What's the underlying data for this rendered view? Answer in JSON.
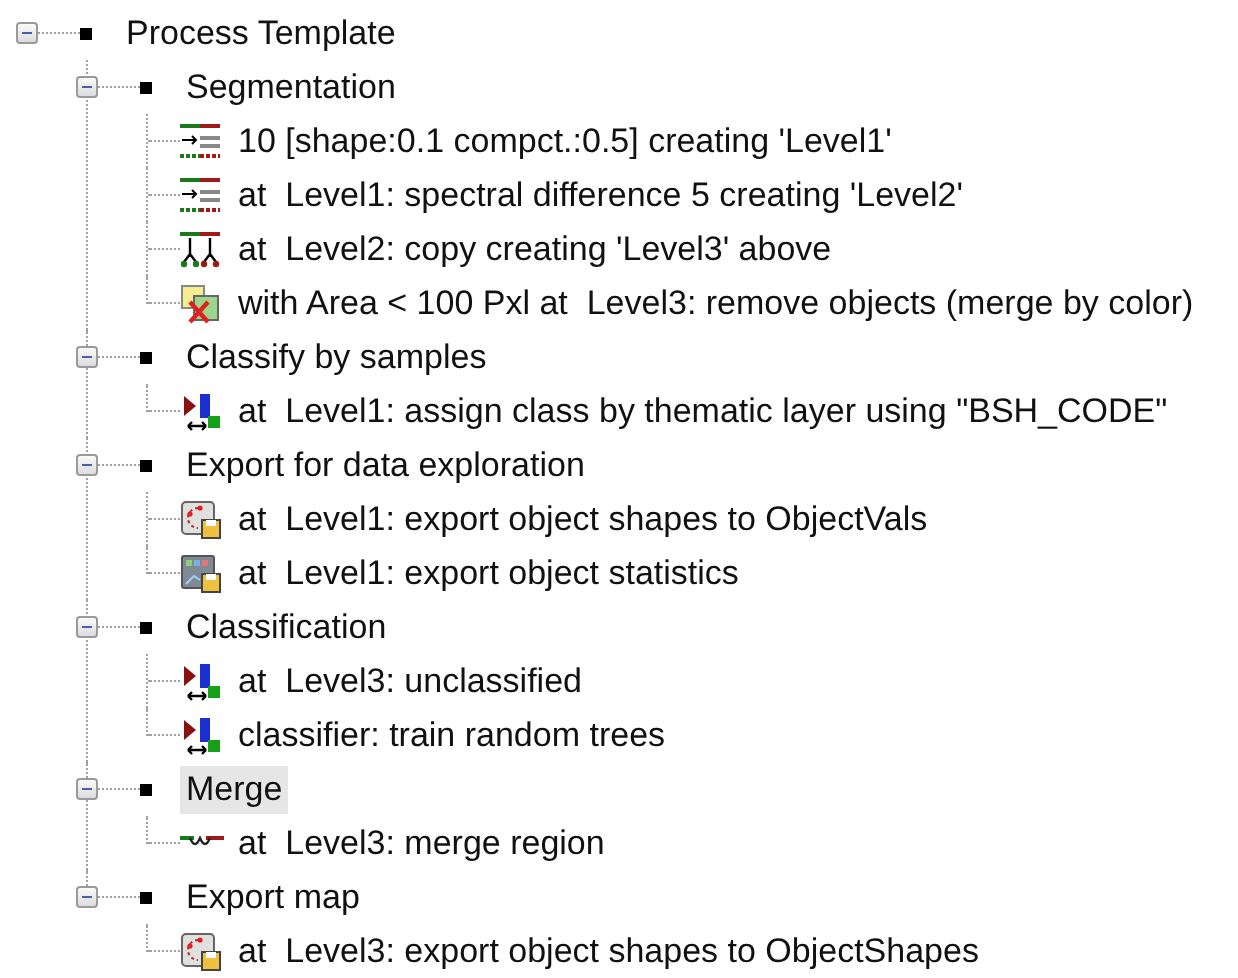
{
  "tree": {
    "label": "Process Template",
    "expanded": true,
    "selected": false,
    "children": [
      {
        "label": "Segmentation",
        "expanded": true,
        "selected": false,
        "children": [
          {
            "label": "10 [shape:0.1 compct.:0.5] creating 'Level1'",
            "kind": "segmentation",
            "selected": false
          },
          {
            "label": "at  Level1: spectral difference 5 creating 'Level2'",
            "kind": "segmentation",
            "selected": false
          },
          {
            "label": "at  Level2: copy creating 'Level3' above",
            "kind": "copy",
            "selected": false
          },
          {
            "label": "with Area < 100 Pxl at  Level3: remove objects (merge by color)",
            "kind": "remove",
            "selected": false
          }
        ]
      },
      {
        "label": "Classify by samples",
        "expanded": true,
        "selected": false,
        "children": [
          {
            "label": "at  Level1: assign class by thematic layer using \"BSH_CODE\"",
            "kind": "classify",
            "selected": false
          }
        ]
      },
      {
        "label": "Export for data exploration",
        "expanded": true,
        "selected": false,
        "children": [
          {
            "label": "at  Level1: export object shapes to ObjectVals",
            "kind": "export-shapes",
            "selected": false
          },
          {
            "label": "at  Level1: export object statistics",
            "kind": "export-stats",
            "selected": false
          }
        ]
      },
      {
        "label": "Classification",
        "expanded": true,
        "selected": false,
        "children": [
          {
            "label": "at  Level3: unclassified",
            "kind": "classify",
            "selected": false
          },
          {
            "label": "classifier: train random trees",
            "kind": "classify",
            "selected": false
          }
        ]
      },
      {
        "label": "Merge",
        "expanded": true,
        "selected": true,
        "children": [
          {
            "label": "at  Level3: merge region",
            "kind": "merge",
            "selected": false
          }
        ]
      },
      {
        "label": "Export map",
        "expanded": true,
        "selected": false,
        "children": [
          {
            "label": "at  Level3: export object shapes to ObjectShapes",
            "kind": "export-shapes",
            "selected": false
          }
        ]
      }
    ]
  }
}
